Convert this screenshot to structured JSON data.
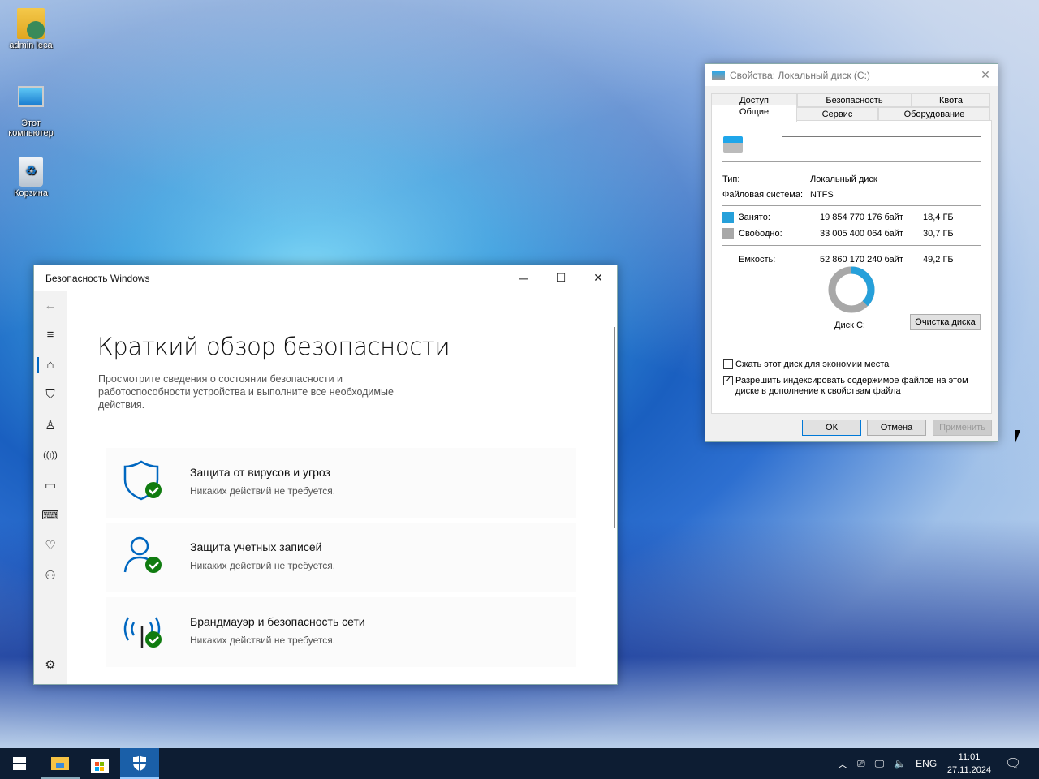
{
  "desktop": {
    "icons": [
      {
        "label": "admin leca",
        "icon": "user-folder-icon"
      },
      {
        "label": "Этот компьютер",
        "icon": "computer-icon"
      },
      {
        "label": "Корзина",
        "icon": "recycle-bin-icon"
      }
    ]
  },
  "security": {
    "title": "Безопасность Windows",
    "heading": "Краткий обзор безопасности",
    "description": "Просмотрите сведения о состоянии безопасности и работоспособности устройства и выполните все необходимые действия.",
    "nav": [
      "back-icon",
      "menu-icon",
      "home-icon",
      "shield-icon",
      "person-icon",
      "wireless-icon",
      "app-browser-icon",
      "laptop-icon",
      "heart-icon",
      "family-icon",
      "settings-icon"
    ],
    "cards": [
      {
        "title": "Защита от вирусов и угроз",
        "status": "Никаких действий не требуется."
      },
      {
        "title": "Защита учетных записей",
        "status": "Никаких действий не требуется."
      },
      {
        "title": "Брандмауэр и безопасность сети",
        "status": "Никаких действий не требуется."
      }
    ],
    "accent": "#0067c0",
    "ok_color": "#107c10"
  },
  "properties": {
    "title": "Свойства: Локальный диск (C:)",
    "tabs_back": [
      "Доступ",
      "Безопасность",
      "Квота"
    ],
    "tabs_front": [
      "Общие",
      "Сервис",
      "Оборудование"
    ],
    "active_tab": "Общие",
    "name_value": "",
    "type_label": "Тип:",
    "type_value": "Локальный диск",
    "fs_label": "Файловая система:",
    "fs_value": "NTFS",
    "used_label": "Занято:",
    "used_bytes": "19 854 770 176 байт",
    "used_gb": "18,4 ГБ",
    "free_label": "Свободно:",
    "free_bytes": "33 005 400 064 байт",
    "free_gb": "30,7 ГБ",
    "cap_label": "Емкость:",
    "cap_bytes": "52 860 170 240 байт",
    "cap_gb": "49,2 ГБ",
    "used_fraction": 0.3756,
    "used_color": "#26a0da",
    "free_color": "#a8a8a8",
    "disk_label": "Диск C:",
    "cleanup": "Очистка диска",
    "compress": "Сжать этот диск для экономии места",
    "compress_checked": false,
    "index": "Разрешить индексировать содержимое файлов на этом диске в дополнение к свойствам файла",
    "index_checked": true,
    "ok": "ОК",
    "cancel": "Отмена",
    "apply": "Применить"
  },
  "taskbar": {
    "apps": [
      "start-icon",
      "file-explorer-icon",
      "store-icon",
      "windows-security-icon"
    ],
    "lang": "ENG",
    "time": "11:01",
    "date": "27.11.2024"
  }
}
